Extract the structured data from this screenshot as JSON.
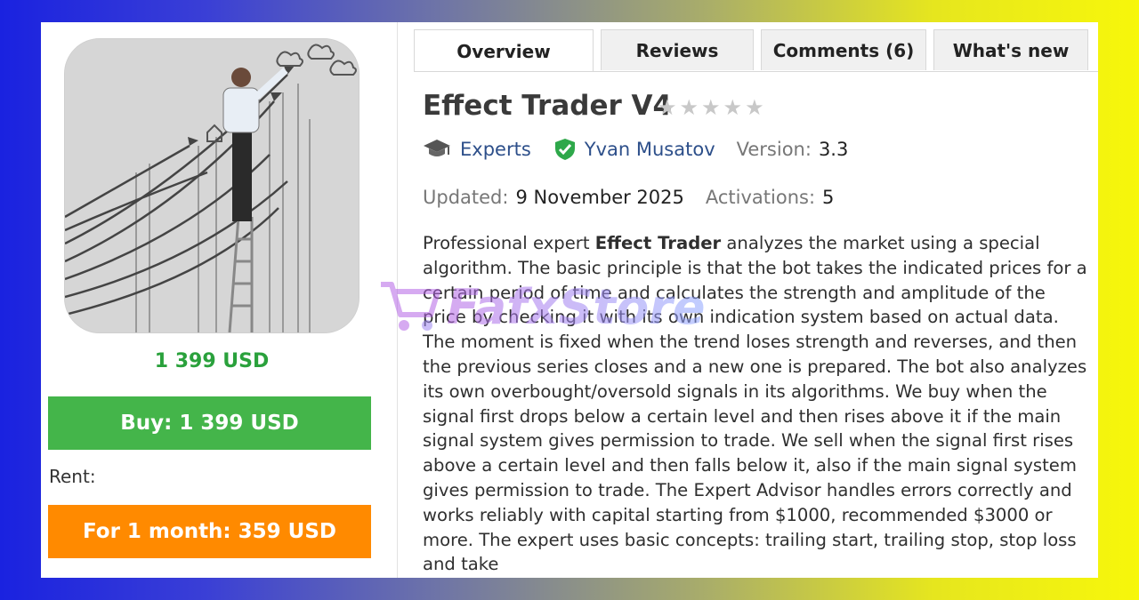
{
  "product": {
    "price": "1 399 USD",
    "buy_label": "Buy: 1 399 USD",
    "rent_label": "Rent:",
    "rent_option": "For 1 month: 359 USD"
  },
  "tabs": [
    {
      "label": "Overview",
      "active": true
    },
    {
      "label": "Reviews",
      "active": false
    },
    {
      "label": "Comments (6)",
      "active": false
    },
    {
      "label": "What's new",
      "active": false
    }
  ],
  "title": "Effect Trader V4",
  "rating": {
    "stars": 0,
    "max": 5
  },
  "meta": {
    "category": "Experts",
    "author": "Yvan Musatov",
    "version_label": "Version:",
    "version": "3.3",
    "updated_label": "Updated:",
    "updated": "9 November 2025",
    "activations_label": "Activations:",
    "activations": "5"
  },
  "description": {
    "intro": "Professional expert ",
    "bold": "Effect Trader",
    "body": " analyzes the market using a special algorithm. The basic principle is that the bot takes the indicated prices for a certain period of time and calculates the strength and amplitude of the price by checking it with its own indication system based on actual data. The moment is fixed when the trend loses strength and reverses, and then the previous series closes and a new one is prepared. The bot also analyzes its own overbought/oversold signals in its algorithms. We buy when the signal first drops below a certain level and then rises above it if the main signal system gives permission to trade. We sell when the signal first rises above a certain level and then falls below it, also if the main signal system gives permission to trade. The Expert Advisor handles errors correctly and works reliably with capital starting from $1000, recommended $3000 or more. The expert uses basic concepts: trailing start, trailing stop, stop loss and take"
  },
  "watermark": "FafxStore",
  "colors": {
    "price_green": "#2aa13c",
    "buy_green": "#44b54a",
    "rent_orange": "#ff8a00",
    "link_blue": "#2d4f8a",
    "verified_green": "#2ea84a"
  }
}
